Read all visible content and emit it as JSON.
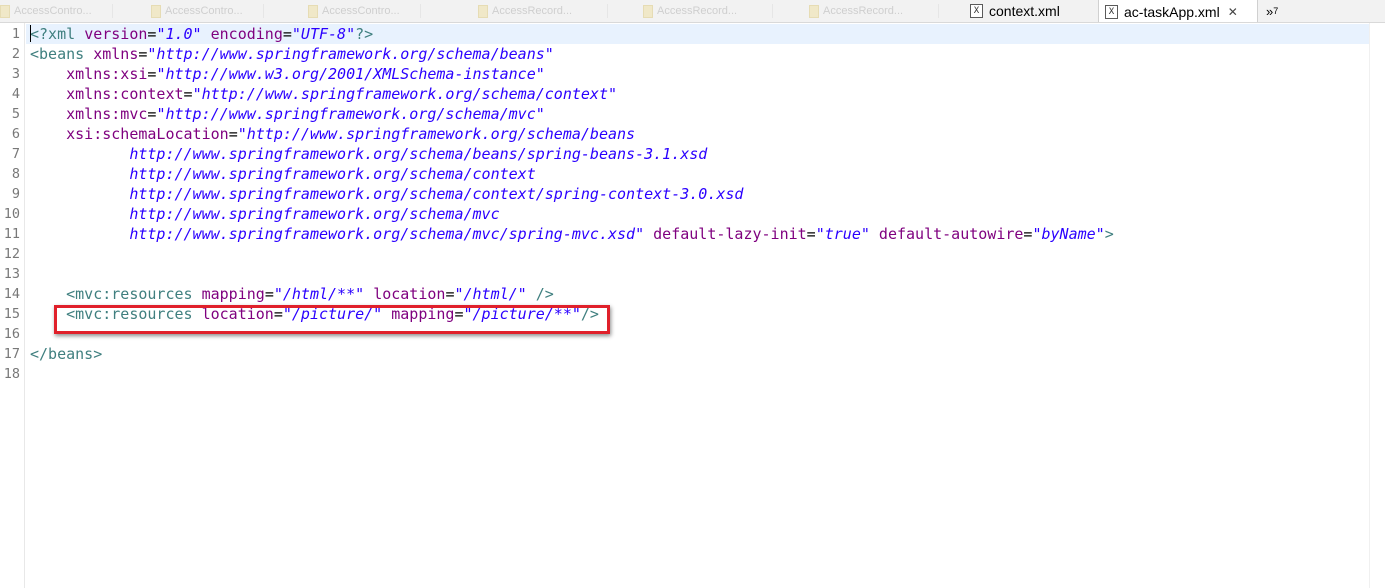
{
  "tabs": {
    "faded": [
      "AccessContro...",
      "AccessContro...",
      "AccessContro...",
      "AccessRecord...",
      "AccessRecord...",
      "AccessRecord..."
    ],
    "context": "context.xml",
    "active": "ac-taskApp.xml",
    "close_glyph": "✕",
    "overflow": "»",
    "overflow_count": "7",
    "file_icon": "X"
  },
  "editor": {
    "line_numbers": [
      "1",
      "2",
      "3",
      "4",
      "5",
      "6",
      "7",
      "8",
      "9",
      "10",
      "11",
      "12",
      "13",
      "14",
      "15",
      "16",
      "17",
      "18"
    ],
    "current_line": 1,
    "highlight_box_line": 15,
    "colors": {
      "tag": "#3f7f7f",
      "attribute": "#7f007f",
      "value": "#2a00ff",
      "highlight_box": "#e0202a",
      "current_line": "#e8f2fe"
    },
    "lines": [
      [
        [
          "t",
          "<?xml "
        ],
        [
          "a",
          "version"
        ],
        [
          "p",
          "="
        ],
        [
          "v",
          "\"1.0\""
        ],
        [
          "p",
          " "
        ],
        [
          "a",
          "encoding"
        ],
        [
          "p",
          "="
        ],
        [
          "v",
          "\"UTF-8\""
        ],
        [
          "t",
          "?>"
        ]
      ],
      [
        [
          "t",
          "<beans "
        ],
        [
          "a",
          "xmlns"
        ],
        [
          "p",
          "="
        ],
        [
          "v",
          "\"http://www.springframework.org/schema/beans\""
        ]
      ],
      [
        [
          "p",
          "    "
        ],
        [
          "a",
          "xmlns:xsi"
        ],
        [
          "p",
          "="
        ],
        [
          "v",
          "\"http://www.w3.org/2001/XMLSchema-instance\""
        ]
      ],
      [
        [
          "p",
          "    "
        ],
        [
          "a",
          "xmlns:context"
        ],
        [
          "p",
          "="
        ],
        [
          "v",
          "\"http://www.springframework.org/schema/context\""
        ]
      ],
      [
        [
          "p",
          "    "
        ],
        [
          "a",
          "xmlns:mvc"
        ],
        [
          "p",
          "="
        ],
        [
          "v",
          "\"http://www.springframework.org/schema/mvc\""
        ]
      ],
      [
        [
          "p",
          "    "
        ],
        [
          "a",
          "xsi:schemaLocation"
        ],
        [
          "p",
          "="
        ],
        [
          "v",
          "\"http://www.springframework.org/schema/beans"
        ]
      ],
      [
        [
          "p",
          "           "
        ],
        [
          "v",
          "http://www.springframework.org/schema/beans/spring-beans-3.1.xsd"
        ]
      ],
      [
        [
          "p",
          "           "
        ],
        [
          "v",
          "http://www.springframework.org/schema/context"
        ]
      ],
      [
        [
          "p",
          "           "
        ],
        [
          "v",
          "http://www.springframework.org/schema/context/spring-context-3.0.xsd"
        ]
      ],
      [
        [
          "p",
          "           "
        ],
        [
          "v",
          "http://www.springframework.org/schema/mvc"
        ]
      ],
      [
        [
          "p",
          "           "
        ],
        [
          "v",
          "http://www.springframework.org/schema/mvc/spring-mvc.xsd\""
        ],
        [
          "p",
          " "
        ],
        [
          "a",
          "default-lazy-init"
        ],
        [
          "p",
          "="
        ],
        [
          "v",
          "\"true\""
        ],
        [
          "p",
          " "
        ],
        [
          "a",
          "default-autowire"
        ],
        [
          "p",
          "="
        ],
        [
          "v",
          "\"byName\""
        ],
        [
          "t",
          ">"
        ]
      ],
      [],
      [],
      [
        [
          "p",
          "    "
        ],
        [
          "t",
          "<mvc:resources "
        ],
        [
          "a",
          "mapping"
        ],
        [
          "p",
          "="
        ],
        [
          "v",
          "\"/html/**\""
        ],
        [
          "p",
          " "
        ],
        [
          "a",
          "location"
        ],
        [
          "p",
          "="
        ],
        [
          "v",
          "\"/html/\""
        ],
        [
          "p",
          " "
        ],
        [
          "t",
          "/>"
        ]
      ],
      [
        [
          "p",
          "    "
        ],
        [
          "t",
          "<mvc:resources "
        ],
        [
          "a",
          "location"
        ],
        [
          "p",
          "="
        ],
        [
          "v",
          "\"/picture/\""
        ],
        [
          "p",
          " "
        ],
        [
          "a",
          "mapping"
        ],
        [
          "p",
          "="
        ],
        [
          "v",
          "\"/picture/**\""
        ],
        [
          "t",
          "/>"
        ]
      ],
      [],
      [
        [
          "t",
          "</beans>"
        ]
      ],
      []
    ]
  }
}
